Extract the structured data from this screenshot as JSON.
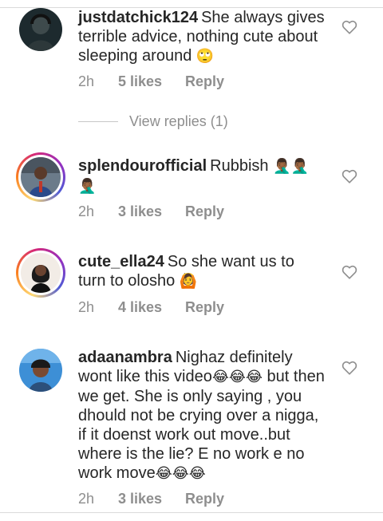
{
  "comments": [
    {
      "username": "justdatchick124",
      "text": "She always gives terrible advice, nothing cute about sleeping around",
      "emoji": "🙄",
      "time": "2h",
      "likes": "5 likes",
      "reply": "Reply"
    },
    {
      "username": "splendourofficial",
      "text": "Rubbish",
      "emoji": "🤦🏾‍♂️🤦🏾‍♂️🤦🏾‍♂️",
      "time": "2h",
      "likes": "3 likes",
      "reply": "Reply"
    },
    {
      "username": "cute_ella24",
      "text": "So she want us to turn to olosho",
      "emoji": "🙆",
      "time": "2h",
      "likes": "4 likes",
      "reply": "Reply"
    },
    {
      "username": "adaanambra",
      "text_a": "Nighaz definitely wont like this video",
      "emoji_a": "😂😂😂",
      "text_b": "but then we get. She is only saying , you dhould not be crying over a nigga, if it doenst work out move..but where is the lie? E no work e no work move",
      "emoji_b": "😂😂😂",
      "time": "2h",
      "likes": "3 likes",
      "reply": "Reply"
    }
  ],
  "view_replies": "View replies (1)",
  "icons": {
    "like": "heart-outline-icon"
  },
  "colors": {
    "text": "#262626",
    "muted": "#8e8e8e",
    "divider": "#dbdbdb"
  }
}
